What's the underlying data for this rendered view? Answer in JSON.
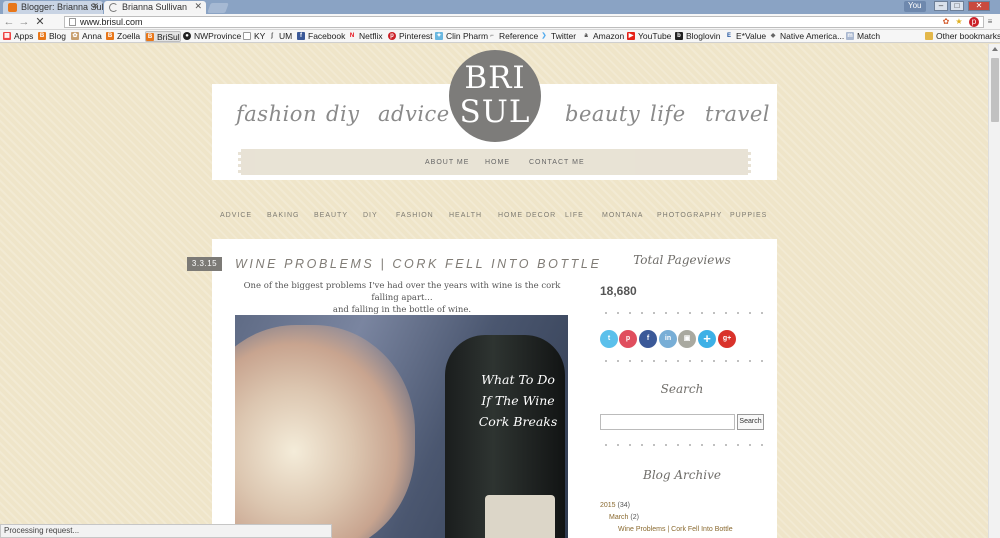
{
  "browser": {
    "tabs": [
      {
        "title": "Blogger: Brianna Sul",
        "active": false
      },
      {
        "title": "Brianna Sullivan",
        "active": true
      }
    ],
    "user_badge": "You",
    "url": "www.brisul.com",
    "bookmarks": [
      "Apps",
      "Blog",
      "Anna",
      "Zoella",
      "BriSul",
      "NWProvince",
      "KY",
      "UM",
      "Facebook",
      "Netflix",
      "Pinterest",
      "Clin Pharm",
      "Reference",
      "Twitter",
      "Amazon",
      "YouTube",
      "Bloglovin",
      "E*Value",
      "Native America...",
      "Match"
    ],
    "other_bookmarks": "Other bookmarks",
    "status": "Processing request..."
  },
  "header": {
    "categories_left": [
      "fashion",
      "diy",
      "advice"
    ],
    "categories_right": [
      "beauty",
      "life",
      "travel"
    ],
    "logo_line1": "BRI",
    "logo_line2": "SUL",
    "top_links": [
      "ABOUT ME",
      "HOME",
      "CONTACT ME"
    ]
  },
  "category_nav": [
    "ADVICE",
    "BAKING",
    "BEAUTY",
    "DIY",
    "FASHION",
    "HEALTH",
    "HOME DECOR",
    "LIFE",
    "MONTANA",
    "PHOTOGRAPHY",
    "PUPPIES"
  ],
  "post": {
    "date": "3.3.15",
    "title": "WINE PROBLEMS | CORK FELL INTO BOTTLE",
    "excerpt_line1": "One of the biggest problems I've had over the years with wine is the cork falling apart...",
    "excerpt_line2": "and falling in the bottle of wine.",
    "image_caption_lines": [
      "What To Do",
      "If The Wine",
      "Cork Breaks"
    ]
  },
  "sidebar": {
    "pageviews_title": "Total Pageviews",
    "pageviews_count": "18,680",
    "social": [
      {
        "name": "twitter",
        "glyph": "t",
        "color": "#5bc0eb"
      },
      {
        "name": "pinterest",
        "glyph": "p",
        "color": "#e04e5e"
      },
      {
        "name": "facebook",
        "glyph": "f",
        "color": "#3b5998"
      },
      {
        "name": "linkedin",
        "glyph": "in",
        "color": "#78aed6"
      },
      {
        "name": "instagram",
        "glyph": "▣",
        "color": "#a9a9a0"
      },
      {
        "name": "bloglovin",
        "glyph": "+",
        "color": "#3db0e6"
      },
      {
        "name": "google-plus",
        "glyph": "g+",
        "color": "#d9322b"
      }
    ],
    "search_title": "Search",
    "search_button": "Search",
    "archive_title": "Blog Archive",
    "archive_year": "2015",
    "archive_year_count": "(34)",
    "archive_month": "March",
    "archive_month_count": "(2)",
    "archive_post": "Wine Problems | Cork Fell Into Bottle"
  }
}
